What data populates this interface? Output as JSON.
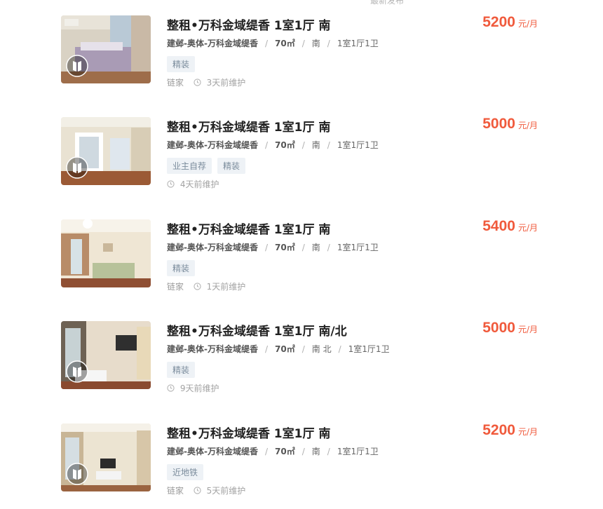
{
  "top_partial_text": "最新发布",
  "listings": [
    {
      "title": "整租•万科金域缇香 1室1厅 南",
      "location": "建邺-奥体-万科金域缇香",
      "area": "70㎡",
      "orientation": "南",
      "layout": "1室1厅1卫",
      "tags": [
        "精装"
      ],
      "brand": "链家",
      "maintained": "3天前维护",
      "price": "5200",
      "price_unit": "元/月"
    },
    {
      "title": "整租•万科金域缇香 1室1厅 南",
      "location": "建邺-奥体-万科金域缇香",
      "area": "70㎡",
      "orientation": "南",
      "layout": "1室1厅1卫",
      "tags": [
        "业主自荐",
        "精装"
      ],
      "brand": "",
      "maintained": "4天前维护",
      "price": "5000",
      "price_unit": "元/月"
    },
    {
      "title": "整租•万科金域缇香 1室1厅 南",
      "location": "建邺-奥体-万科金域缇香",
      "area": "70㎡",
      "orientation": "南",
      "layout": "1室1厅1卫",
      "tags": [
        "精装"
      ],
      "brand": "链家",
      "maintained": "1天前维护",
      "price": "5400",
      "price_unit": "元/月"
    },
    {
      "title": "整租•万科金域缇香 1室1厅 南/北",
      "location": "建邺-奥体-万科金域缇香",
      "area": "70㎡",
      "orientation": "南 北",
      "layout": "1室1厅1卫",
      "tags": [
        "精装"
      ],
      "brand": "",
      "maintained": "9天前维护",
      "price": "5000",
      "price_unit": "元/月"
    },
    {
      "title": "整租•万科金域缇香 1室1厅 南",
      "location": "建邺-奥体-万科金域缇香",
      "area": "70㎡",
      "orientation": "南",
      "layout": "1室1厅1卫",
      "tags": [
        "近地铁"
      ],
      "brand": "链家",
      "maintained": "5天前维护",
      "price": "5200",
      "price_unit": "元/月"
    }
  ],
  "icons": {
    "vr": "vr-tour-icon",
    "clock": "clock-icon"
  },
  "colors": {
    "price": "#f05a3c",
    "tag_bg": "#eef2f6",
    "tag_text": "#7b8c9c"
  }
}
